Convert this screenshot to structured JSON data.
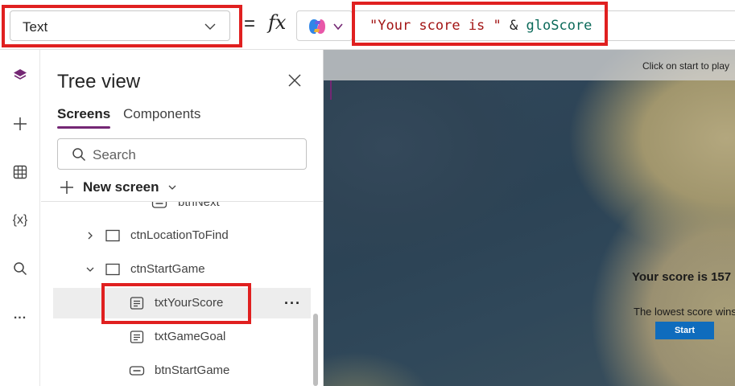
{
  "formula_bar": {
    "property": "Text",
    "equals": "=",
    "fx": "fx",
    "formula": {
      "string_literal": "\"Your score is \"",
      "operator": "&",
      "variable": "gloScore"
    }
  },
  "rail": {
    "items": [
      {
        "name": "tree-view",
        "icon": "layers-icon"
      },
      {
        "name": "insert",
        "icon": "plus-icon"
      },
      {
        "name": "data",
        "icon": "table-icon"
      },
      {
        "name": "variables",
        "icon": "variables-icon",
        "text": "{x}"
      },
      {
        "name": "search",
        "icon": "search-icon"
      },
      {
        "name": "more",
        "icon": "ellipsis-icon",
        "text": "..."
      }
    ]
  },
  "tree_view": {
    "title": "Tree view",
    "tabs": [
      "Screens",
      "Components"
    ],
    "active_tab": "Screens",
    "search_placeholder": "Search",
    "new_screen_label": "New screen",
    "nodes": [
      {
        "label": "btnNext",
        "icon": "button-icon"
      },
      {
        "label": "ctnLocationToFind",
        "icon": "container-icon",
        "expander": "collapsed"
      },
      {
        "label": "ctnStartGame",
        "icon": "container-icon",
        "expander": "expanded"
      },
      {
        "label": "txtYourScore",
        "icon": "text-label-icon",
        "selected": true
      },
      {
        "label": "txtGameGoal",
        "icon": "text-label-icon"
      },
      {
        "label": "btnStartGame",
        "icon": "button-icon"
      }
    ],
    "more_label": "···"
  },
  "canvas": {
    "hint": "Click on start to play",
    "score_text": "Your score is 157",
    "goal_text": "The lowest score wins",
    "start_button": "Start"
  },
  "colors": {
    "highlight": "#e02020",
    "accent": "#742774",
    "start_button": "#0f6cbd"
  }
}
